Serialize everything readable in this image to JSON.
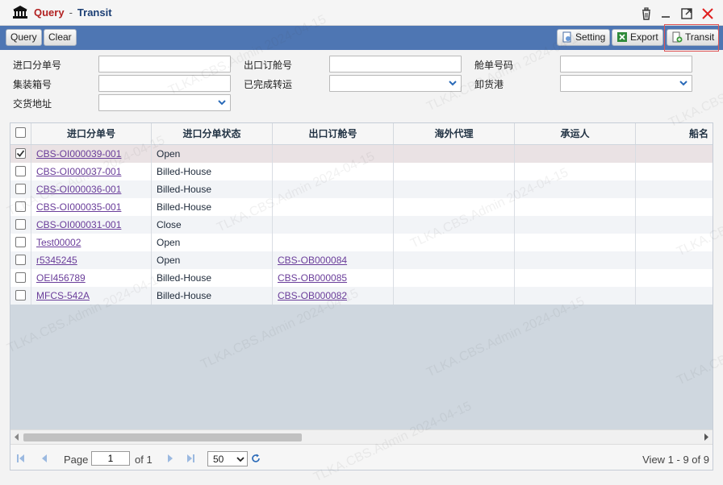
{
  "window": {
    "title_left": "Query",
    "title_sep": "-",
    "title_right": "Transit"
  },
  "toolbar": {
    "query_label": "Query",
    "clear_label": "Clear",
    "setting_label": "Setting",
    "export_label": "Export",
    "transit_label": "Transit"
  },
  "form": {
    "import_hbl_label": "进口分单号",
    "export_booking_label": "出口订舱号",
    "bill_no_label": "舱单号码",
    "container_label": "集装箱号",
    "transit_done_label": "已完成转运",
    "discharge_port_label": "卸货港",
    "delivery_label": "交货地址"
  },
  "grid": {
    "columns": [
      "进口分单号",
      "进口分单状态",
      "出口订舱号",
      "海外代理",
      "承运人",
      "船名"
    ],
    "rows": [
      {
        "hbl": "CBS-OI000039-001",
        "status": "Open",
        "booking": "",
        "checked": true
      },
      {
        "hbl": "CBS-OI000037-001",
        "status": "Billed-House",
        "booking": "",
        "checked": false
      },
      {
        "hbl": "CBS-OI000036-001",
        "status": "Billed-House",
        "booking": "",
        "checked": false
      },
      {
        "hbl": "CBS-OI000035-001",
        "status": "Billed-House",
        "booking": "",
        "checked": false
      },
      {
        "hbl": "CBS-OI000031-001",
        "status": "Close",
        "booking": "",
        "checked": false
      },
      {
        "hbl": "Test00002",
        "status": "Open",
        "booking": "",
        "checked": false
      },
      {
        "hbl": "r5345245",
        "status": "Open",
        "booking": "CBS-OB000084",
        "checked": false
      },
      {
        "hbl": "OEI456789",
        "status": "Billed-House",
        "booking": "CBS-OB000085",
        "checked": false
      },
      {
        "hbl": "MFCS-542A",
        "status": "Billed-House",
        "booking": "CBS-OB000082",
        "checked": false
      }
    ]
  },
  "pager": {
    "page_label": "Page",
    "page_value": "1",
    "of_label": "of 1",
    "page_size": "50",
    "summary": "View 1 - 9 of 9"
  },
  "watermark": "TLKA.CBS.Admin 2024-04-15",
  "colors": {
    "toolbar": "#4e76b3",
    "title_red": "#b22222",
    "title_blue": "#1c3f74",
    "link": "#6a3d9a"
  }
}
